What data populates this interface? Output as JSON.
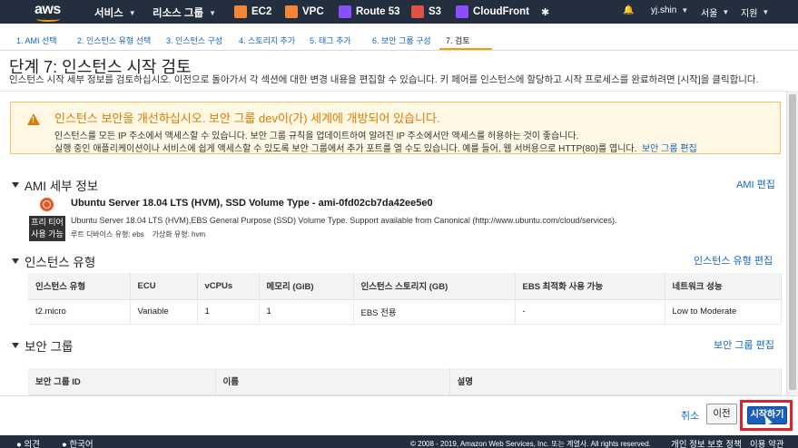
{
  "topnav": {
    "logo": "aws",
    "services": "서비스",
    "resource_groups": "리소스 그룹",
    "shortcuts": [
      {
        "label": "EC2",
        "icon": "ec2-icon",
        "color": "#f58536"
      },
      {
        "label": "VPC",
        "icon": "vpc-icon",
        "color": "#f58536"
      },
      {
        "label": "Route 53",
        "icon": "route53-icon",
        "color": "#8c4fff"
      },
      {
        "label": "S3",
        "icon": "s3-icon",
        "color": "#e05243"
      },
      {
        "label": "CloudFront",
        "icon": "cloudfront-icon",
        "color": "#8c4fff"
      }
    ],
    "pin_icon": "pin-icon",
    "bell_icon": "bell-icon",
    "user": "yj.shin",
    "region": "서울",
    "support": "지원"
  },
  "wizard": {
    "steps": [
      "1. AMI 선택",
      "2. 인스턴스 유형 선택",
      "3. 인스턴스 구성",
      "4. 스토리지 추가",
      "5. 태그 추가",
      "6. 보안 그룹 구성",
      "7. 검토"
    ],
    "active_index": 6
  },
  "page": {
    "title": "단계 7: 인스턴스 시작 검토",
    "description": "인스턴스 시작 세부 정보를 검토하십시오. 이전으로 돌아가서 각 섹션에 대한 변경 내용을 편집할 수 있습니다. 키 페어를 인스턴스에 할당하고 시작 프로세스를 완료하려면 [시작]을 클릭합니다."
  },
  "warning": {
    "title": "인스턴스 보안을 개선하십시오. 보안 그룹 dev이(가) 세계에 개방되어 있습니다.",
    "line1": "인스턴스를 모든 IP 주소에서 액세스할 수 있습니다. 보안 그룹 규칙을 업데이트하여 알려진 IP 주소에서만 액세스를 허용하는 것이 좋습니다.",
    "line2": "실행 중인 애플리케이션이나 서비스에 쉽게 액세스할 수 있도록 보안 그룹에서 추가 포트를 열 수도 있습니다. 예를 들어, 웹 서버용으로 HTTP(80)를 엽니다.",
    "link": "보안 그룹 편집"
  },
  "ami": {
    "heading": "AMI 세부 정보",
    "edit": "AMI 편집",
    "name": "Ubuntu Server 18.04 LTS (HVM), SSD Volume Type - ami-0fd02cb7da42ee5e0",
    "badge_line1": "프리 티어",
    "badge_line2": "사용 가능",
    "description": "Ubuntu Server 18.04 LTS (HVM),EBS General Purpose (SSD) Volume Type. Support available from Canonical (http://www.ubuntu.com/cloud/services).",
    "root_device": "루트 디바이스 유형: ebs",
    "virtualization": "가상화 유형: hvm"
  },
  "instance_type": {
    "heading": "인스턴스 유형",
    "edit": "인스턴스 유형 편집",
    "columns": [
      "인스턴스 유형",
      "ECU",
      "vCPUs",
      "메모리 (GiB)",
      "인스턴스 스토리지 (GB)",
      "EBS 최적화 사용 가능",
      "네트워크 성능"
    ],
    "row": [
      "t2.micro",
      "Variable",
      "1",
      "1",
      "EBS 전용",
      "-",
      "Low to Moderate"
    ]
  },
  "security_group": {
    "heading": "보안 그룹",
    "edit": "보안 그룹 편집",
    "columns": [
      "보안 그룹 ID",
      "이름",
      "설명"
    ]
  },
  "actions": {
    "cancel": "취소",
    "previous": "이전",
    "launch": "시작하기"
  },
  "footer": {
    "feedback": "의견",
    "language": "한국어",
    "copyright": "© 2008 - 2019, Amazon Web Services, Inc. 또는 계열사. All rights reserved.",
    "privacy": "개인 정보 보호 정책",
    "terms": "이용 약관"
  }
}
